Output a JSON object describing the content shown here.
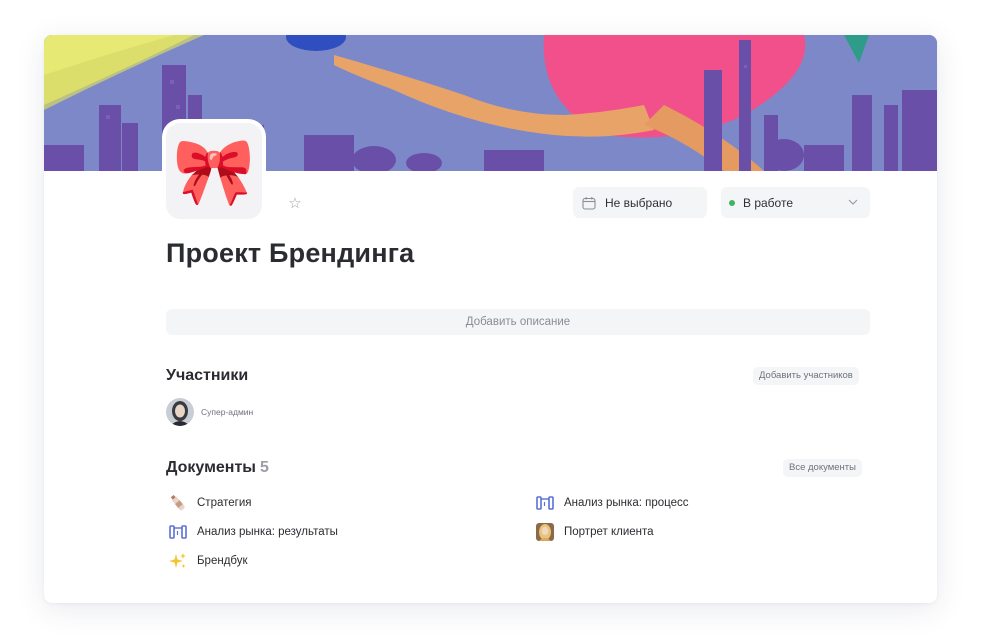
{
  "header": {
    "date_label": "Не выбрано",
    "status_label": "В работе",
    "status_color": "#3fb462"
  },
  "project": {
    "icon": "bow-emoji",
    "title": "Проект Брендинга",
    "add_description": "Добавить описание"
  },
  "members": {
    "title": "Участники",
    "add_label": "Добавить участников",
    "list": [
      {
        "role": "Супер-админ"
      }
    ]
  },
  "documents": {
    "title": "Документы",
    "count": "5",
    "all_label": "Все документы",
    "items": [
      {
        "label": "Стратегия",
        "icon": "bottle-icon"
      },
      {
        "label": "Анализ рынка: процесс",
        "icon": "measure-icon"
      },
      {
        "label": "Анализ рынка: результаты",
        "icon": "measure-icon"
      },
      {
        "label": "Портрет клиента",
        "icon": "portrait-icon"
      },
      {
        "label": "Брендбук",
        "icon": "sparkles-icon"
      }
    ]
  }
}
